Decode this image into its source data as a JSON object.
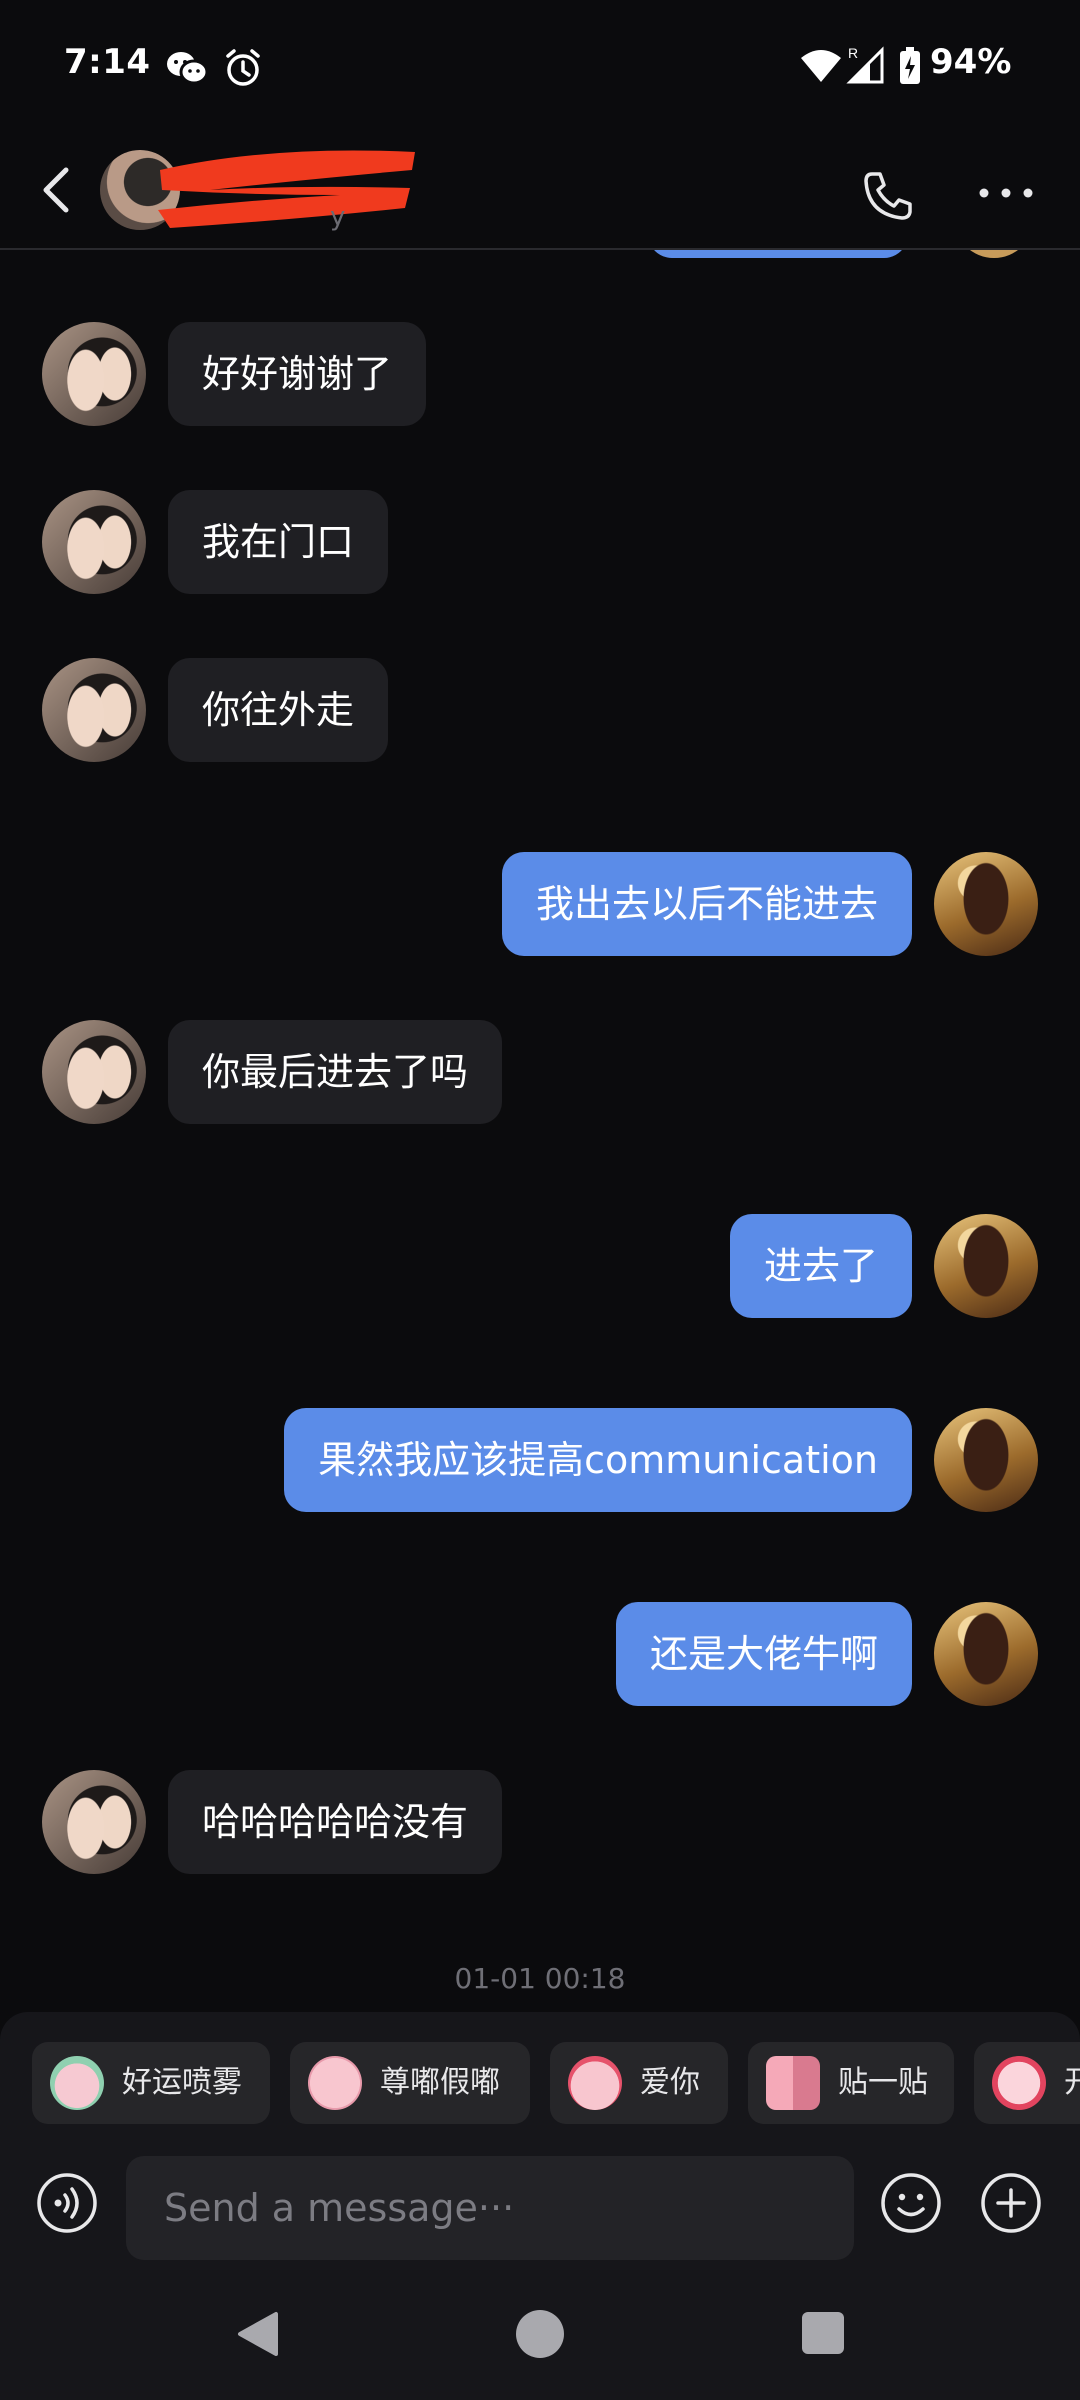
{
  "status_bar": {
    "time": "7:14",
    "battery": "94%",
    "icons": [
      "wechat-icon",
      "alarm-icon",
      "wifi-icon",
      "signal-icon",
      "battery-charging-icon"
    ]
  },
  "header": {
    "subtitle_fragment": "y"
  },
  "messages": [
    {
      "side": "in",
      "text": "好好谢谢了"
    },
    {
      "side": "in",
      "text": "我在门口"
    },
    {
      "side": "in",
      "text": "你往外走"
    },
    {
      "side": "out",
      "text": "我出去以后不能进去"
    },
    {
      "side": "in",
      "text": "你最后进去了吗"
    },
    {
      "side": "out",
      "text": "进去了"
    },
    {
      "side": "out",
      "text": "果然我应该提高communication"
    },
    {
      "side": "out",
      "text": "还是大佬牛啊"
    },
    {
      "side": "in",
      "text": "哈哈哈哈哈没有"
    }
  ],
  "timestamp": "01-01 00:18",
  "quick_reactions": [
    {
      "label": "好运喷雾",
      "icon": "lucky-spray-emoji"
    },
    {
      "label": "尊嘟假嘟",
      "icon": "pig-face-emoji"
    },
    {
      "label": "爱你",
      "icon": "love-you-emoji"
    },
    {
      "label": "贴一贴",
      "icon": "cuddle-emoji"
    },
    {
      "label": "开",
      "icon": "happy-emoji"
    }
  ],
  "input": {
    "placeholder": "Send a message···"
  },
  "colors": {
    "background": "#0b0b0d",
    "bubble_in": "#1f1f23",
    "bubble_out": "#5b8ce8",
    "redaction": "#f03a1e"
  }
}
